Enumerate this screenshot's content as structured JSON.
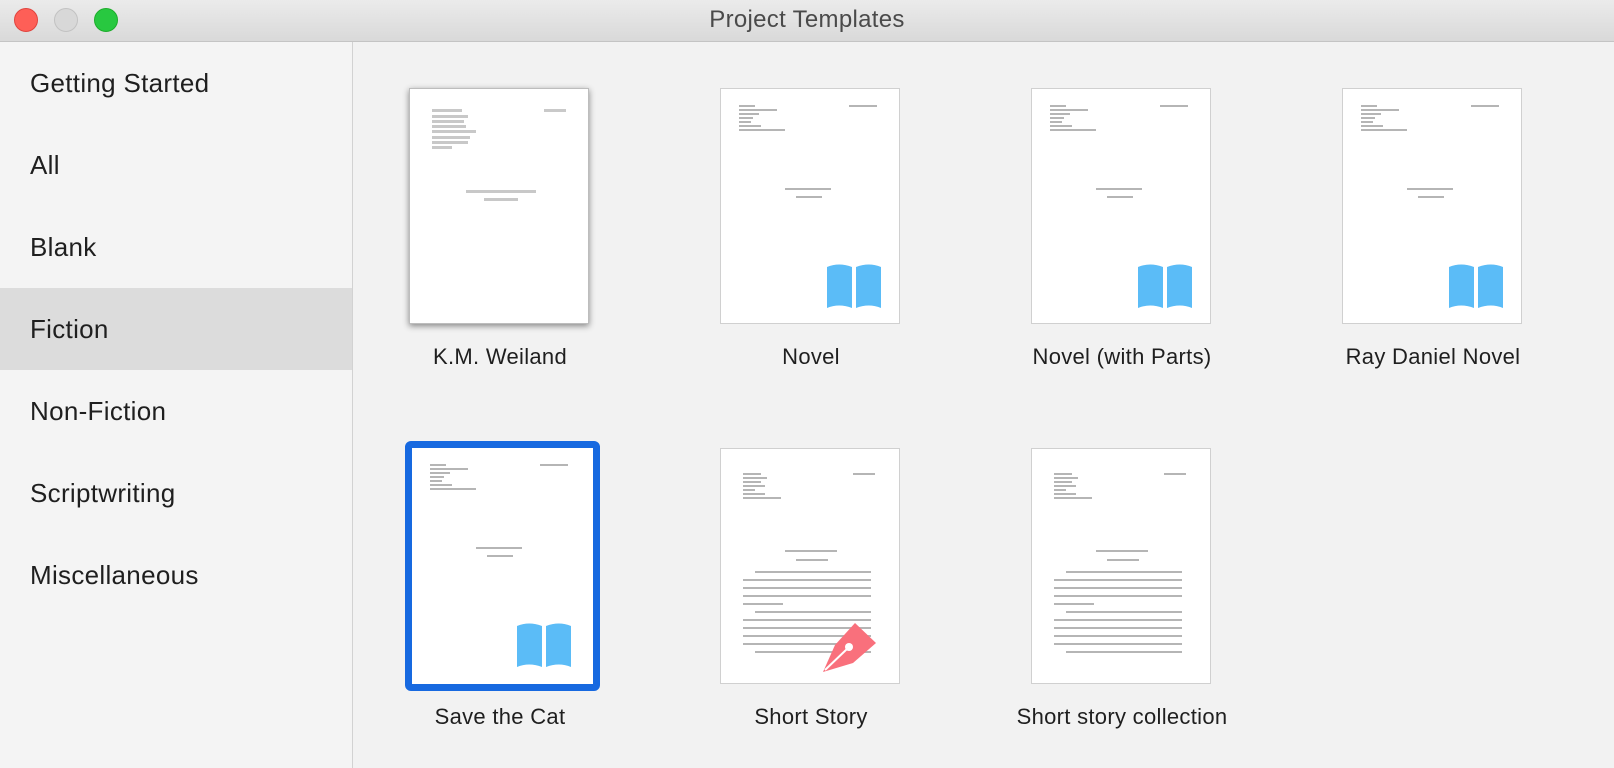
{
  "window": {
    "title": "Project Templates"
  },
  "sidebar": {
    "items": [
      {
        "label": "Getting Started"
      },
      {
        "label": "All"
      },
      {
        "label": "Blank"
      },
      {
        "label": "Fiction"
      },
      {
        "label": "Non-Fiction"
      },
      {
        "label": "Scriptwriting"
      },
      {
        "label": "Miscellaneous"
      }
    ],
    "selected": "Fiction"
  },
  "templates": [
    {
      "label": "K.M. Weiland",
      "icon": "none"
    },
    {
      "label": "Novel",
      "icon": "book-icon"
    },
    {
      "label": "Novel (with Parts)",
      "icon": "book-icon"
    },
    {
      "label": "Ray Daniel Novel",
      "icon": "book-icon"
    },
    {
      "label": "Save the Cat",
      "icon": "book-icon",
      "selected": true
    },
    {
      "label": "Short Story",
      "icon": "pen-icon"
    },
    {
      "label": "Short story collection",
      "icon": "none"
    }
  ],
  "colors": {
    "selection": "#1769e0",
    "book_icon": "#5bbcf7",
    "pen_icon": "#f9707c"
  }
}
